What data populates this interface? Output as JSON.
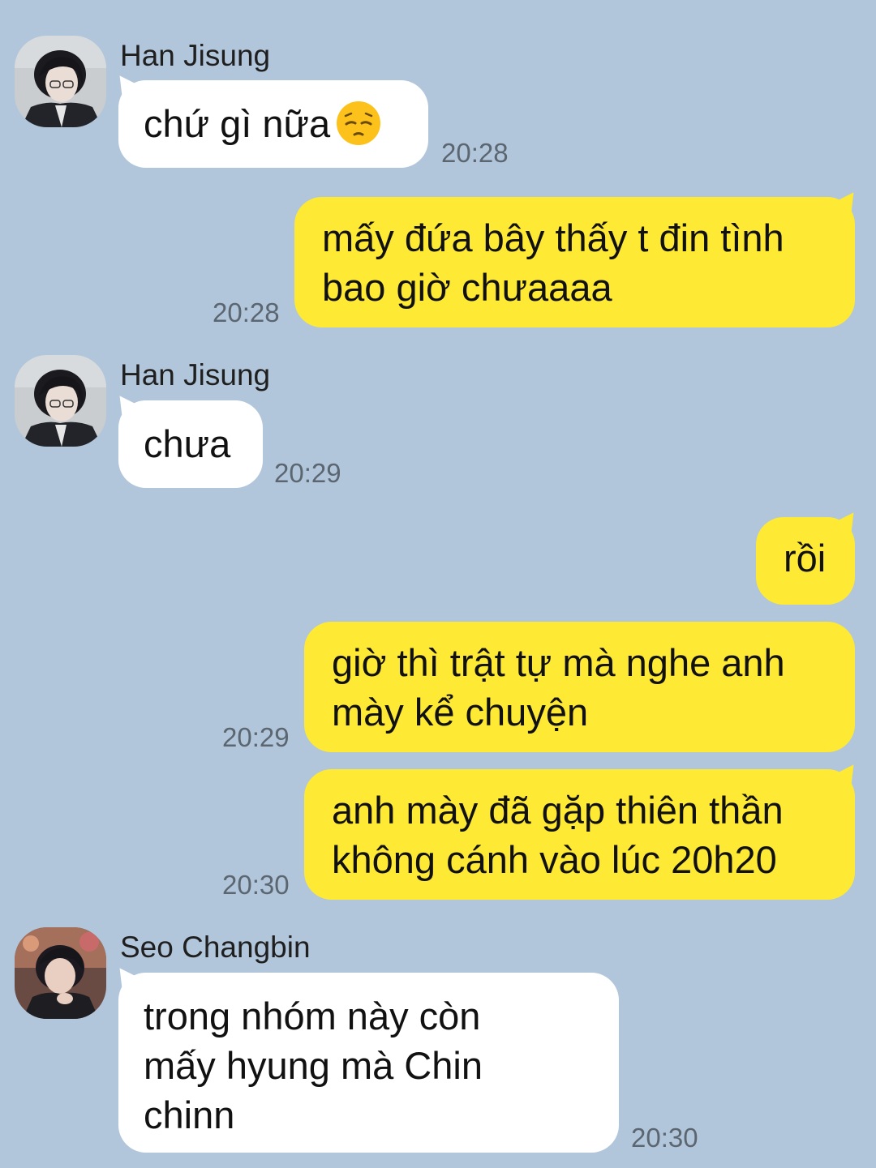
{
  "messages": [
    {
      "sender": "Han Jisung",
      "lines": [
        "chứ gì nữa"
      ],
      "emoji": "pensive-face-emoji",
      "time": "20:28"
    },
    {
      "lines": [
        "mấy đứa bây thấy t đin tình",
        "bao giờ chưaaaa"
      ],
      "time": "20:28"
    },
    {
      "sender": "Han Jisung",
      "lines": [
        "chưa"
      ],
      "time": "20:29"
    },
    {
      "lines": [
        "rồi"
      ]
    },
    {
      "lines": [
        "giờ thì trật tự mà nghe anh",
        "mày kể chuyện"
      ],
      "time": "20:29"
    },
    {
      "lines": [
        "anh mày đã gặp thiên thần",
        "không cánh vào lúc 20h20"
      ],
      "time": "20:30"
    },
    {
      "sender": "Seo Changbin",
      "lines": [
        "trong nhóm này còn",
        "mấy hyung mà Chin",
        "chinn"
      ],
      "time": "20:30"
    }
  ],
  "colors": {
    "background": "#b2c6db",
    "incoming_bubble": "#ffffff",
    "outgoing_bubble": "#fee934",
    "timestamp": "#5b6670"
  },
  "icons": {
    "avatar_han_jisung": "avatar-han-jisung-photo",
    "avatar_seo_changbin": "avatar-seo-changbin-photo"
  }
}
